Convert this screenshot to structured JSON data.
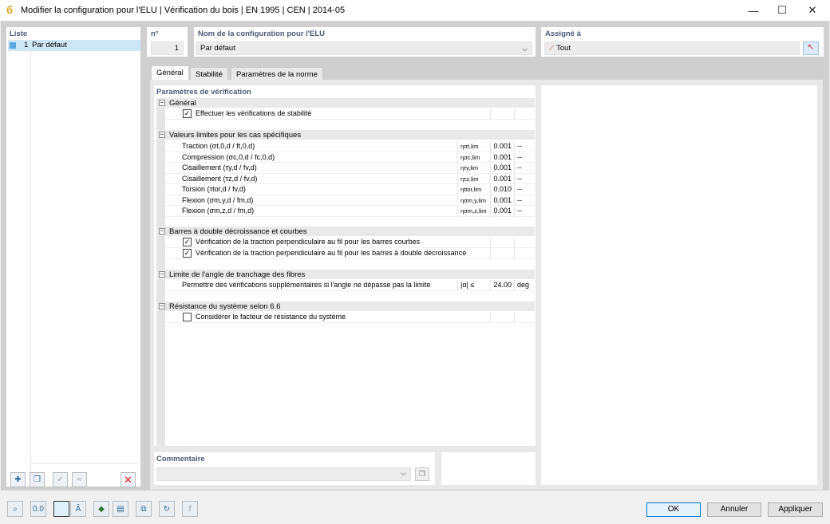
{
  "window": {
    "title": "Modifier la configuration pour l'ELU | Vérification du bois | EN 1995 | CEN | 2014-05",
    "minimize": "—",
    "maximize": "☐",
    "close": "✕"
  },
  "list": {
    "header": "Liste",
    "items": [
      {
        "num": "1",
        "label": "Par défaut"
      }
    ]
  },
  "number": {
    "label": "n°",
    "value": "1"
  },
  "config_name": {
    "label": "Nom de la configuration pour l'ELU",
    "value": "Par défaut"
  },
  "assigned": {
    "label": "Assigné à",
    "value": "Tout"
  },
  "tabs": [
    "Général",
    "Stabilité",
    "Paramètres de la norme"
  ],
  "params": {
    "header": "Paramètres de vérification",
    "groups": {
      "general": {
        "title": "Général",
        "rows": [
          {
            "label": "Effectuer les vérifications de stabilité",
            "checked": true
          }
        ]
      },
      "limits": {
        "title": "Valeurs limites pour les cas spécifiques",
        "rows": [
          {
            "label": "Traction (σt,0,d / ft,0,d)",
            "symbol": "ησt,lim",
            "value": "0.001",
            "unit": "--"
          },
          {
            "label": "Compression (σc,0,d / fc,0,d)",
            "symbol": "ησc,lim",
            "value": "0.001",
            "unit": "--"
          },
          {
            "label": "Cisaillement (τy,d / fv,d)",
            "symbol": "ητy,lim",
            "value": "0.001",
            "unit": "--"
          },
          {
            "label": "Cisaillement (τz,d / fv,d)",
            "symbol": "ητz,lim",
            "value": "0.001",
            "unit": "--"
          },
          {
            "label": "Torsion (τtor,d / fv,d)",
            "symbol": "ηttor,lim",
            "value": "0.010",
            "unit": "--"
          },
          {
            "label": "Flexion (σm,y,d / fm,d)",
            "symbol": "ησm,y,lim",
            "value": "0.001",
            "unit": "--"
          },
          {
            "label": "Flexion (σm,z,d / fm,d)",
            "symbol": "ησm,z,lim",
            "value": "0.001",
            "unit": "--"
          }
        ]
      },
      "tapered": {
        "title": "Barres à double décroissance et courbes",
        "rows": [
          {
            "label": "Vérification de la traction perpendiculaire au fil pour les barres courbes",
            "checked": true
          },
          {
            "label": "Vérification de la traction perpendiculaire au fil pour les barres à double décroissance",
            "checked": true
          }
        ]
      },
      "angle": {
        "title": "Limite de l'angle de tranchage des fibres",
        "rows": [
          {
            "label": "Permettre des vérifications supplémentaires si l'angle ne dépasse pas la limite",
            "symbol": "|α| ≤",
            "value": "24.00",
            "unit": "deg"
          }
        ]
      },
      "system": {
        "title": "Résistance du système selon 6.6",
        "rows": [
          {
            "label": "Considérer le facteur de résistance du système",
            "checked": false
          }
        ]
      }
    }
  },
  "comment": {
    "label": "Commentaire",
    "value": ""
  },
  "buttons": {
    "ok": "OK",
    "cancel": "Annuler",
    "apply": "Appliquer"
  },
  "icons": {
    "delete_color": "#d9262b",
    "accent": "#2d6b9a"
  }
}
